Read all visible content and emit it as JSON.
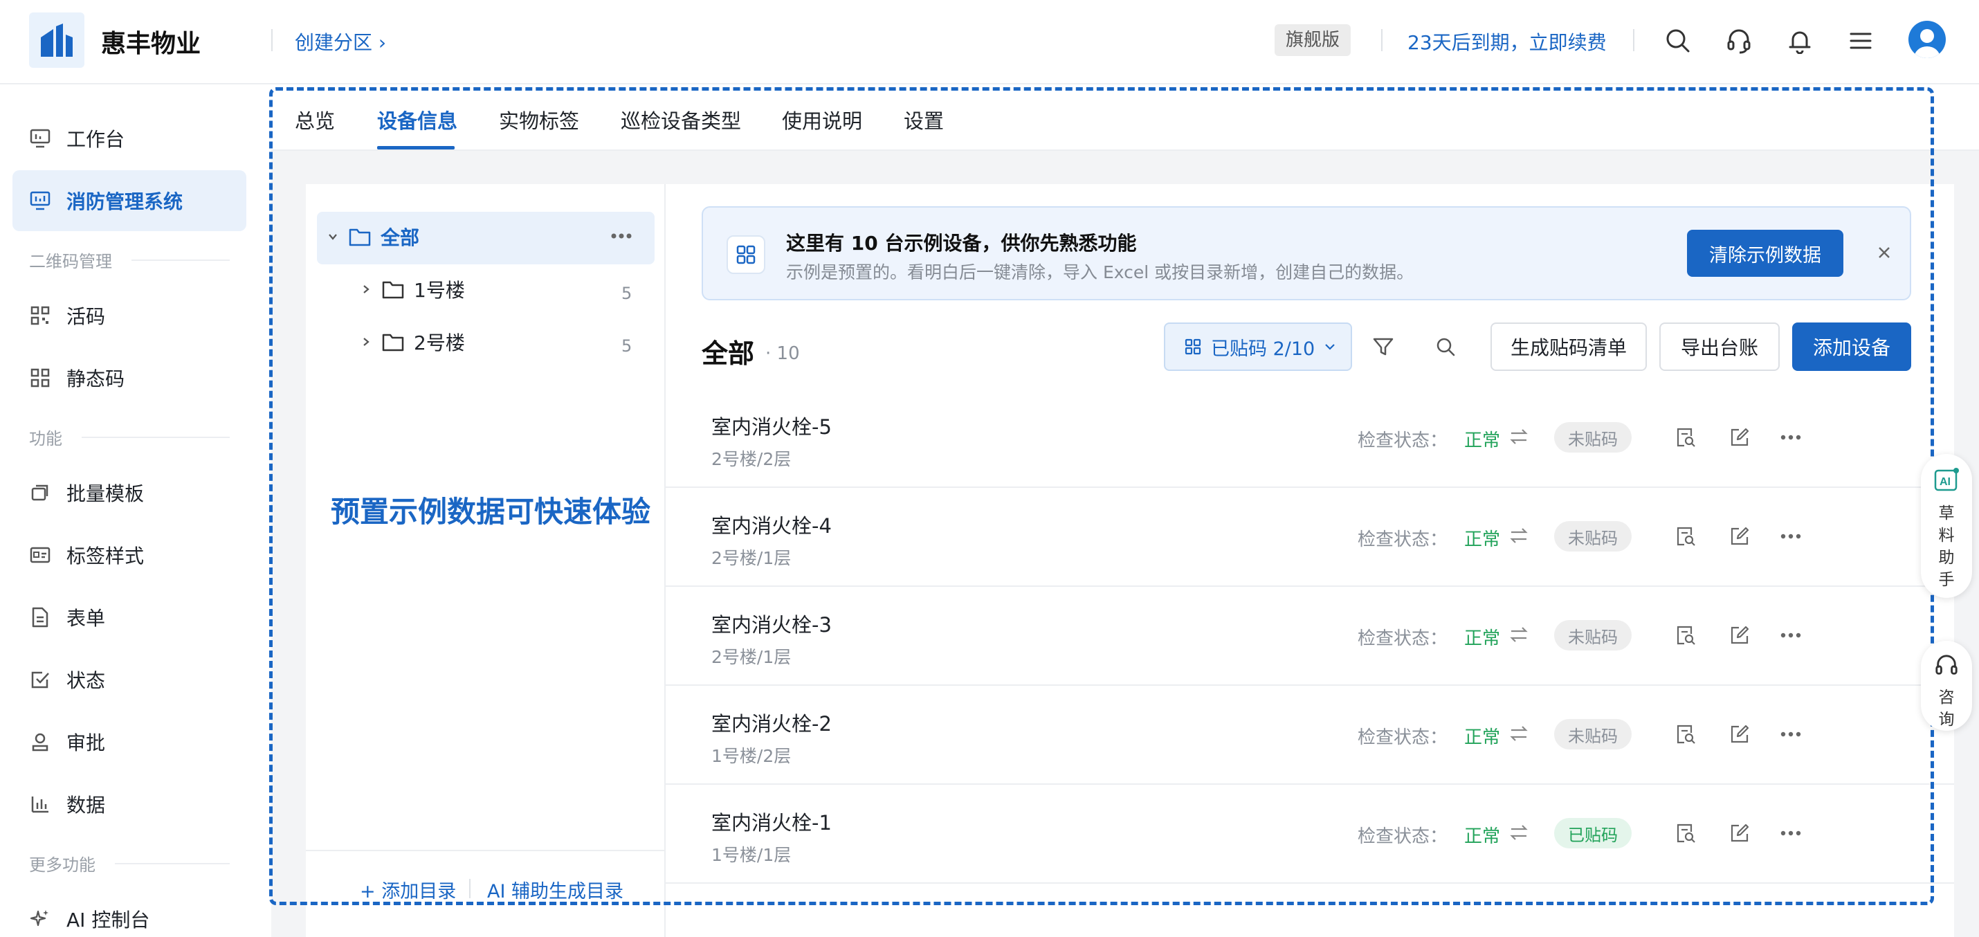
{
  "header": {
    "brand": "惠丰物业",
    "section_link": "创建分区 ›",
    "plan_badge": "旗舰版",
    "expire_link": "23天后到期，立即续费"
  },
  "sidebar": {
    "items": [
      {
        "label": "工作台",
        "icon": "monitor-icon"
      },
      {
        "label": "消防管理系统",
        "icon": "monitor-chart-icon"
      },
      {
        "label": "活码",
        "icon": "qr-code-icon"
      },
      {
        "label": "静态码",
        "icon": "qr-code-icon"
      },
      {
        "label": "批量模板",
        "icon": "copy-icon"
      },
      {
        "label": "标签样式",
        "icon": "id-card-icon"
      },
      {
        "label": "表单",
        "icon": "document-icon"
      },
      {
        "label": "状态",
        "icon": "checkbox-icon"
      },
      {
        "label": "审批",
        "icon": "user-stamp-icon"
      },
      {
        "label": "数据",
        "icon": "bar-chart-icon"
      },
      {
        "label": "AI 控制台",
        "icon": "sparkle-icon"
      }
    ],
    "groups": {
      "qr": "二维码管理",
      "function": "功能",
      "more": "更多功能"
    }
  },
  "tabs": [
    "总览",
    "设备信息",
    "实物标签",
    "巡检设备类型",
    "使用说明",
    "设置"
  ],
  "tree": {
    "root": "全部",
    "children": [
      {
        "label": "1号楼",
        "count": "5"
      },
      {
        "label": "2号楼",
        "count": "5"
      }
    ],
    "footer": {
      "add_dir": "+ 添加目录",
      "ai_dir": "AI 辅助生成目录"
    }
  },
  "promo_text": "预置示例数据可快速体验",
  "notice": {
    "title": "这里有 10 台示例设备，供你先熟悉功能",
    "subtitle": "示例是预置的。看明白后一键清除，导入 Excel 或按目录新增，创建自己的数据。",
    "clear_button": "清除示例数据"
  },
  "list": {
    "title": "全部",
    "count": "· 10",
    "filter": "已贴码 2/10",
    "gen_button": "生成贴码清单",
    "export_button": "导出台账",
    "add_button": "添加设备",
    "status_label": "检查状态：",
    "rows": [
      {
        "name": "室内消火栓-5",
        "loc": "2号楼/2层",
        "status": "正常",
        "tag": "未贴码"
      },
      {
        "name": "室内消火栓-4",
        "loc": "2号楼/1层",
        "status": "正常",
        "tag": "未贴码"
      },
      {
        "name": "室内消火栓-3",
        "loc": "2号楼/1层",
        "status": "正常",
        "tag": "未贴码"
      },
      {
        "name": "室内消火栓-2",
        "loc": "1号楼/2层",
        "status": "正常",
        "tag": "未贴码"
      },
      {
        "name": "室内消火栓-1",
        "loc": "1号楼/1层",
        "status": "正常",
        "tag": "已贴码"
      }
    ]
  },
  "floating": {
    "ai_helper": "草料助手",
    "consult": "咨询"
  },
  "colors": {
    "accent": "#1a66c4",
    "success": "#22a35a"
  }
}
